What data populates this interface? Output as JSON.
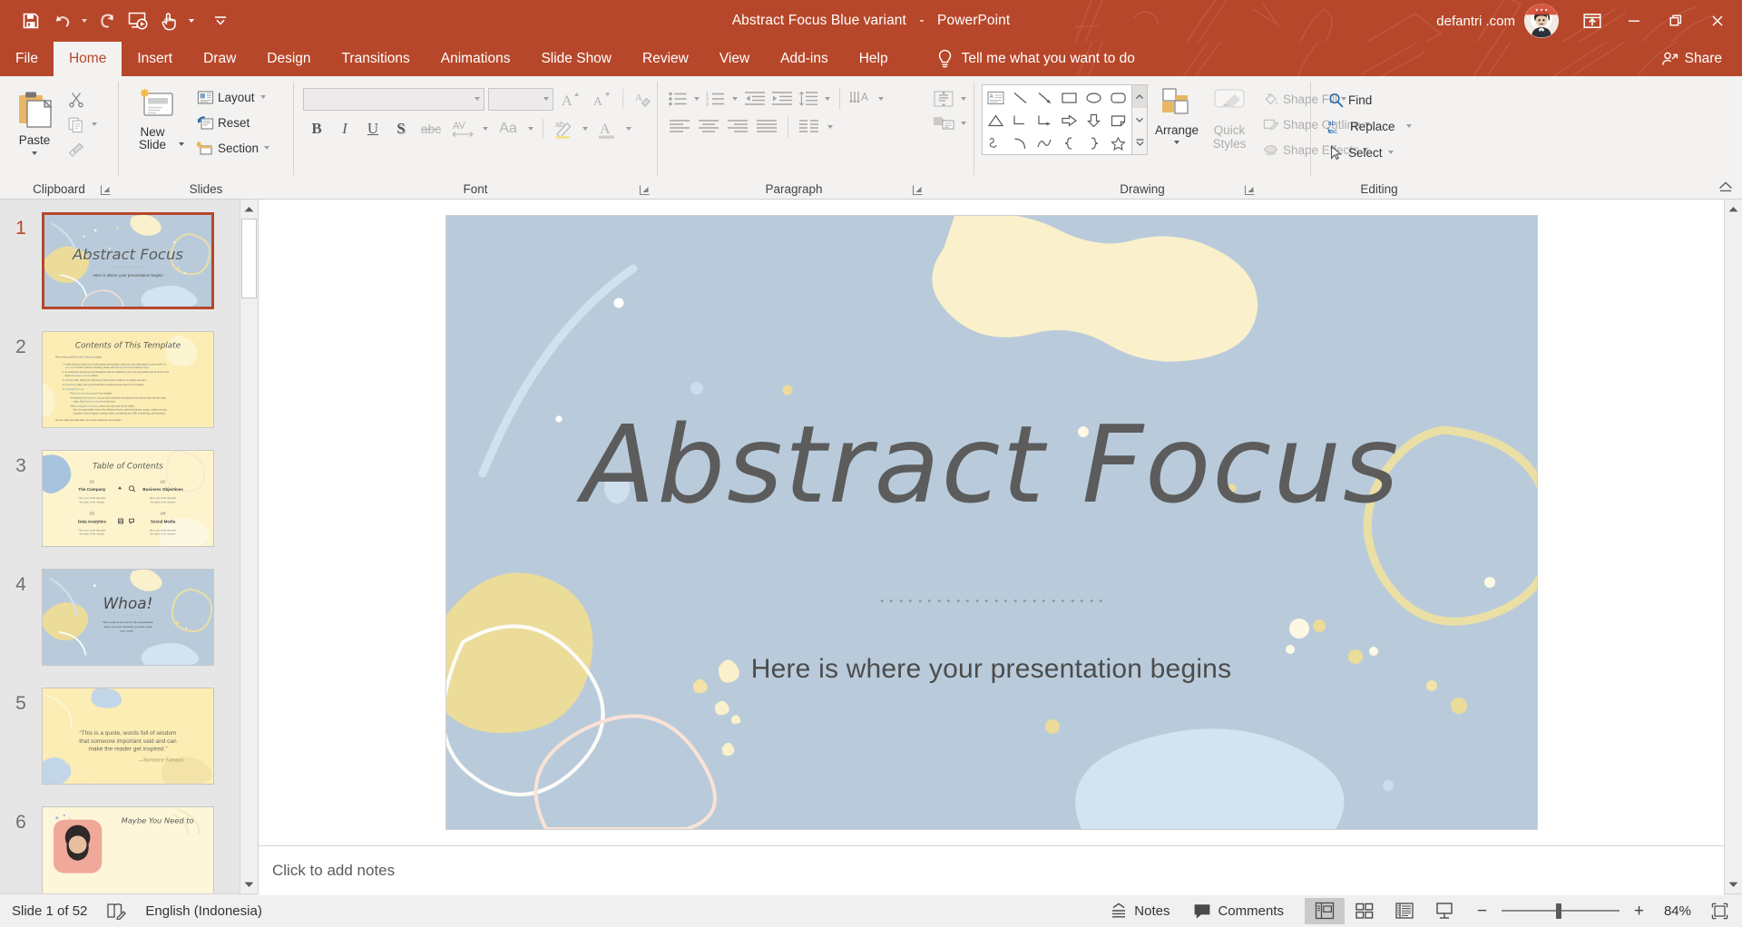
{
  "titlebar": {
    "quick_access": [
      {
        "name": "save-button",
        "label": "Save"
      },
      {
        "name": "undo-button",
        "label": "Undo"
      },
      {
        "name": "redo-button",
        "label": "Redo"
      },
      {
        "name": "start-from-beginning-button",
        "label": "Start From Beginning"
      },
      {
        "name": "touch-mouse-mode-button",
        "label": "Touch/Mouse Mode"
      },
      {
        "name": "customize-quick-access-toolbar-button",
        "label": "Customize Quick Access Toolbar"
      }
    ],
    "document_title": "Abstract Focus Blue variant",
    "separator": "-",
    "app_name": "PowerPoint",
    "account_name": "defantri .com",
    "ribbon_display_options_label": "Ribbon Display Options",
    "minimize_label": "Minimize",
    "restore_label": "Restore Down",
    "close_label": "Close"
  },
  "tabs": [
    {
      "label": "File",
      "active": false
    },
    {
      "label": "Home",
      "active": true
    },
    {
      "label": "Insert",
      "active": false
    },
    {
      "label": "Draw",
      "active": false
    },
    {
      "label": "Design",
      "active": false
    },
    {
      "label": "Transitions",
      "active": false
    },
    {
      "label": "Animations",
      "active": false
    },
    {
      "label": "Slide Show",
      "active": false
    },
    {
      "label": "Review",
      "active": false
    },
    {
      "label": "View",
      "active": false
    },
    {
      "label": "Add-ins",
      "active": false
    },
    {
      "label": "Help",
      "active": false
    }
  ],
  "tell_me": {
    "placeholder": "Tell me what you want to do"
  },
  "share": {
    "label": "Share"
  },
  "ribbon": {
    "clipboard": {
      "group_label": "Clipboard",
      "paste_label": "Paste",
      "cut_label": "Cut",
      "copy_label": "Copy",
      "format_painter_label": "Format Painter"
    },
    "slides": {
      "group_label": "Slides",
      "new_slide_label": "New Slide",
      "layout_label": "Layout",
      "reset_label": "Reset",
      "section_label": "Section"
    },
    "font": {
      "group_label": "Font",
      "font_name_value": "",
      "font_size_value": "",
      "increase_font_label": "Increase Font Size",
      "decrease_font_label": "Decrease Font Size",
      "clear_formatting_label": "Clear All Formatting",
      "bold_label": "B",
      "italic_label": "I",
      "underline_label": "U",
      "shadow_label": "S",
      "strikethrough_label": "abc",
      "character_spacing_label": "AV",
      "change_case_label": "Aa",
      "highlight_label": "Text Highlight Color",
      "font_color_label": "Font Color"
    },
    "paragraph": {
      "group_label": "Paragraph",
      "bullets_label": "Bullets",
      "numbering_label": "Numbering",
      "decrease_indent_label": "Decrease Indent",
      "increase_indent_label": "Increase Indent",
      "line_spacing_label": "Line Spacing",
      "text_direction_label": "Text Direction",
      "align_text_label": "Align Text",
      "convert_smartart_label": "Convert to SmartArt",
      "align_left_label": "Align Left",
      "align_center_label": "Center",
      "align_right_label": "Align Right",
      "justify_label": "Justify",
      "columns_label": "Add or Remove Columns"
    },
    "drawing": {
      "group_label": "Drawing",
      "arrange_label": "Arrange",
      "quick_styles_label": "Quick Styles",
      "shape_fill_label": "Shape Fill",
      "shape_outline_label": "Shape Outline",
      "shape_effects_label": "Shape Effects"
    },
    "editing": {
      "group_label": "Editing",
      "find_label": "Find",
      "replace_label": "Replace",
      "select_label": "Select"
    },
    "collapse_ribbon_label": "Collapse the Ribbon"
  },
  "thumbnails": [
    {
      "number": "1",
      "kind": "title",
      "title": "Abstract Focus",
      "subtitle": "Here is where your presentation begins",
      "selected": true
    },
    {
      "number": "2",
      "kind": "contents",
      "title": "Contents of This Template",
      "selected": false
    },
    {
      "number": "3",
      "kind": "toc",
      "title": "Table of Contents",
      "items": [
        {
          "num": "01",
          "name": "The Company",
          "desc": "Here you could describe the topic of the section"
        },
        {
          "num": "02",
          "name": "Business Objectives",
          "desc": "Here you could describe the topic of the section"
        },
        {
          "num": "03",
          "name": "Data Analytics",
          "desc": "Here you could describe the topic of the section"
        },
        {
          "num": "04",
          "name": "Social Media",
          "desc": "Here you could describe the topic of the section"
        }
      ],
      "selected": false
    },
    {
      "number": "4",
      "kind": "whoa",
      "title": "Whoa!",
      "subtitle": "This could be the part of the presentation where you can introduce yourself, write your email…",
      "selected": false
    },
    {
      "number": "5",
      "kind": "quote",
      "title": "“This is a quote, words full of wisdom that someone important said and can make the reader get inspired.”",
      "author": "—Someone Famous",
      "selected": false
    },
    {
      "number": "6",
      "kind": "photo",
      "title": "Maybe You Need to",
      "selected": false
    }
  ],
  "slide": {
    "title": "Abstract Focus",
    "subtitle": "Here is where your presentation begins",
    "background_color": "#b9cbdb",
    "cream_color": "#faf0cb",
    "yellow_color": "#ecdc9a",
    "light_blue_color": "#d3e3f2",
    "title_color": "#5c5c5c"
  },
  "notes": {
    "placeholder": "Click to add notes"
  },
  "status": {
    "slide_counter": "Slide 1 of 52",
    "spellcheck_label": "Spelling and Grammar Check",
    "language": "English (Indonesia)",
    "notes_label": "Notes",
    "comments_label": "Comments",
    "views": [
      {
        "name": "normal-view-button",
        "label": "Normal",
        "active": true
      },
      {
        "name": "slide-sorter-view-button",
        "label": "Slide Sorter",
        "active": false
      },
      {
        "name": "reading-view-button",
        "label": "Reading View",
        "active": false
      },
      {
        "name": "slide-show-button",
        "label": "Slide Show",
        "active": false
      }
    ],
    "zoom_out_label": "Zoom Out",
    "zoom_in_label": "Zoom In",
    "zoom_value": "84%",
    "fit_slide_label": "Fit slide to current window"
  },
  "colors": {
    "accent": "#b7472a",
    "ribbon_bg": "#f3f2f1",
    "thumb_pane_bg": "#e6e6e6"
  }
}
